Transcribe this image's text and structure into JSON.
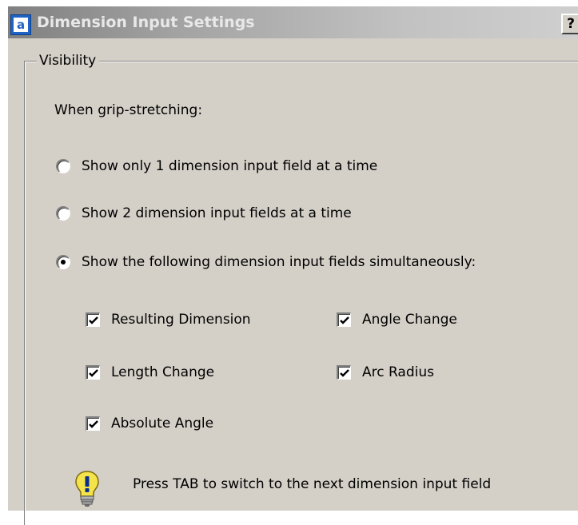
{
  "window": {
    "title": "Dimension Input Settings",
    "app_icon": "autocad-icon",
    "help_label": "?"
  },
  "visibility": {
    "group_label": "Visibility",
    "grip_label": "When grip-stretching:",
    "radios": [
      {
        "label": "Show only 1 dimension input field at a time",
        "checked": false
      },
      {
        "label": "Show 2 dimension input fields at a time",
        "checked": false
      },
      {
        "label": "Show the following dimension input fields simultaneously:",
        "checked": true
      }
    ],
    "checkboxes": [
      {
        "label": "Resulting Dimension",
        "checked": true
      },
      {
        "label": "Angle Change",
        "checked": true
      },
      {
        "label": "Length Change",
        "checked": true
      },
      {
        "label": "Arc Radius",
        "checked": true
      },
      {
        "label": "Absolute Angle",
        "checked": true
      }
    ],
    "tip_icon": "lightbulb-icon",
    "tip_text": "Press TAB to switch to the next dimension input field"
  },
  "colors": {
    "dialog_bg": "#d4d0c8",
    "titlebar_start": "#808080",
    "titlebar_end": "#cfcfcf",
    "icon_blue": "#1f64c4",
    "bulb_yellow": "#f5e34a"
  }
}
